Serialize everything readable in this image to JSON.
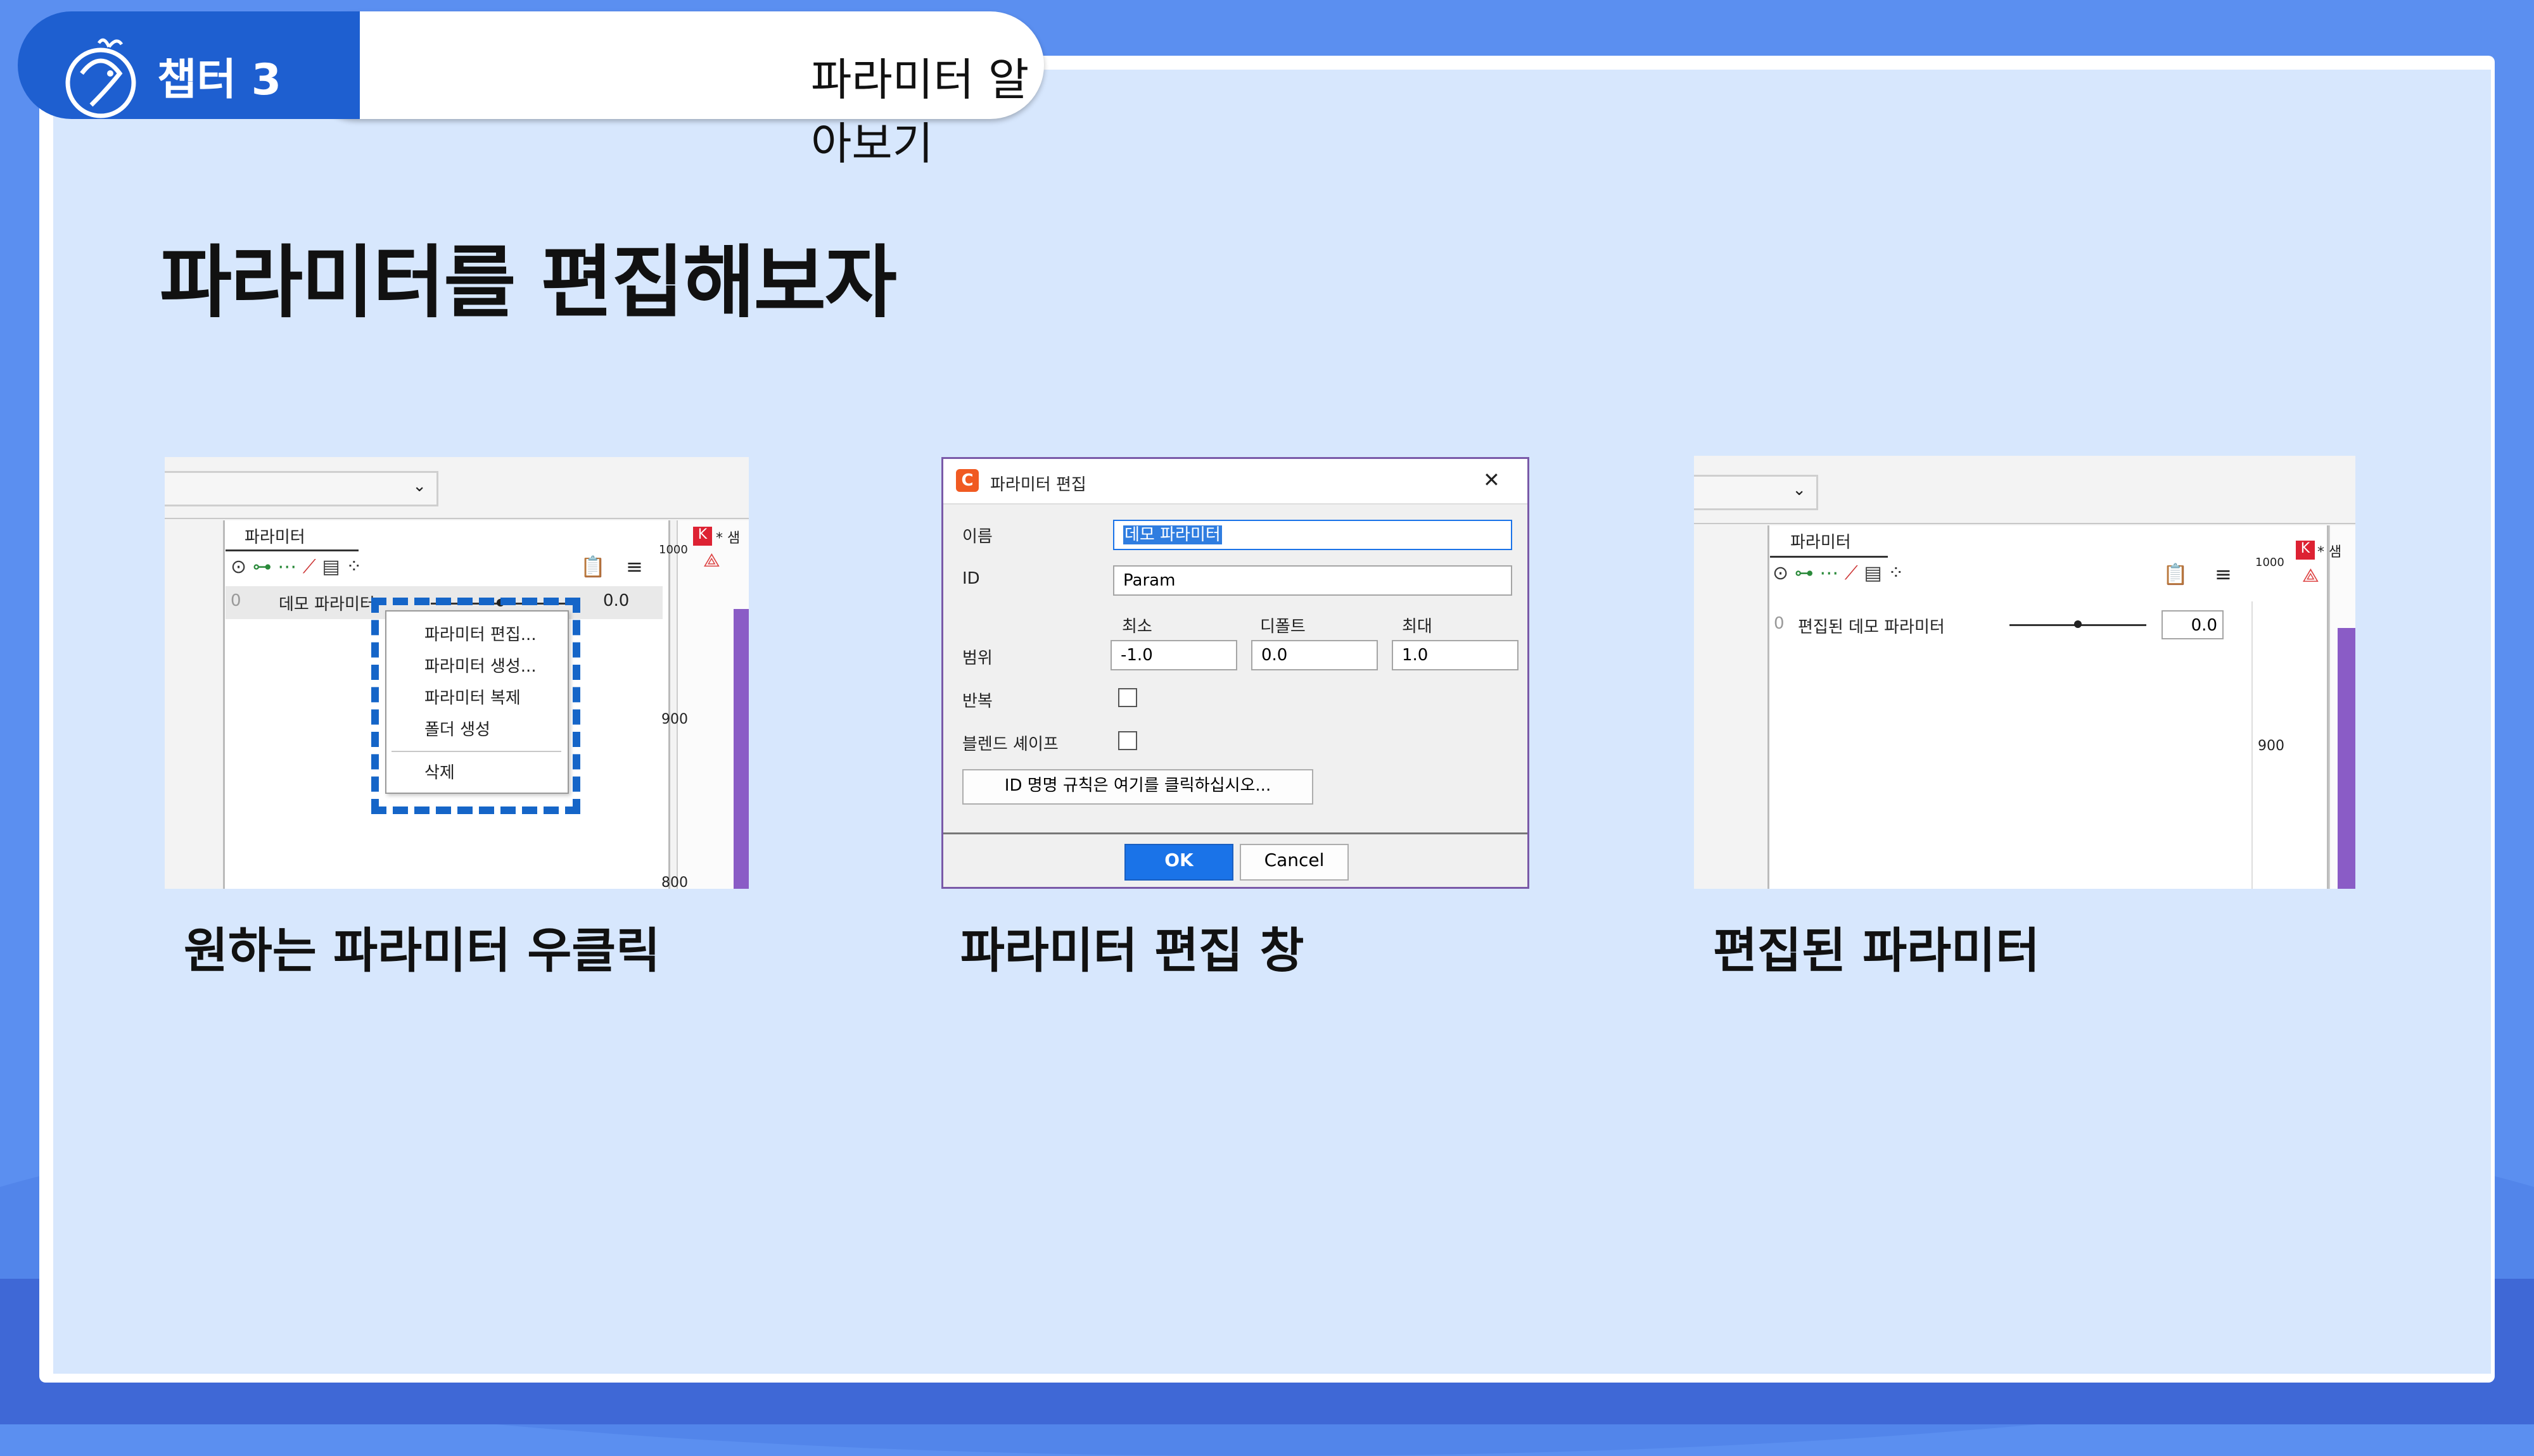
{
  "header": {
    "chapter_label": "챕터 3",
    "chapter_title": "파라미터 알아보기"
  },
  "slide": {
    "heading": "파라미터를 편집해보자"
  },
  "panels": [
    {
      "caption": "원하는 파라미터 우클릭",
      "screenshot": {
        "panel_tab": "파라미터",
        "param_row_index": "0",
        "param_name": "데모 파라미터",
        "param_value": "0.0",
        "ruler_labels": [
          "1000",
          "900",
          "800"
        ],
        "side_tab_label": "* 샘",
        "context_menu": [
          "파라미터 편집...",
          "파라미터 생성...",
          "파라미터 복제",
          "폴더 생성",
          "삭제"
        ]
      }
    },
    {
      "caption": "파라미터 편집 창",
      "dialog": {
        "title": "파라미터 편집",
        "close_glyph": "✕",
        "name_label": "이름",
        "name_value": "데모 파라미터",
        "id_label": "ID",
        "id_value": "Param",
        "min_header": "최소",
        "default_header": "디폴트",
        "max_header": "최대",
        "range_label": "범위",
        "min_value": "-1.0",
        "default_value": "0.0",
        "max_value": "1.0",
        "repeat_label": "반복",
        "blend_label": "블렌드 셰이프",
        "id_rule_button": "ID 명명 규칙은 여기를 클릭하십시오...",
        "ok_button": "OK",
        "cancel_button": "Cancel"
      }
    },
    {
      "caption": "편집된 파라미터",
      "screenshot": {
        "panel_tab": "파라미터",
        "param_row_index": "0",
        "param_name": "편집된 데모 파라미터",
        "param_value": "0.0",
        "slider_position": 0.5,
        "ruler_labels": [
          "1000",
          "900"
        ],
        "side_tab_label": "* 샘"
      }
    }
  ],
  "colors": {
    "background": "#5b8ff0",
    "card": "#d7e7fd",
    "accent": "#1e5fd0",
    "dashed_highlight": "#1565c8",
    "ok_button": "#1a73e8",
    "purple_bar": "#8a5cc6"
  }
}
